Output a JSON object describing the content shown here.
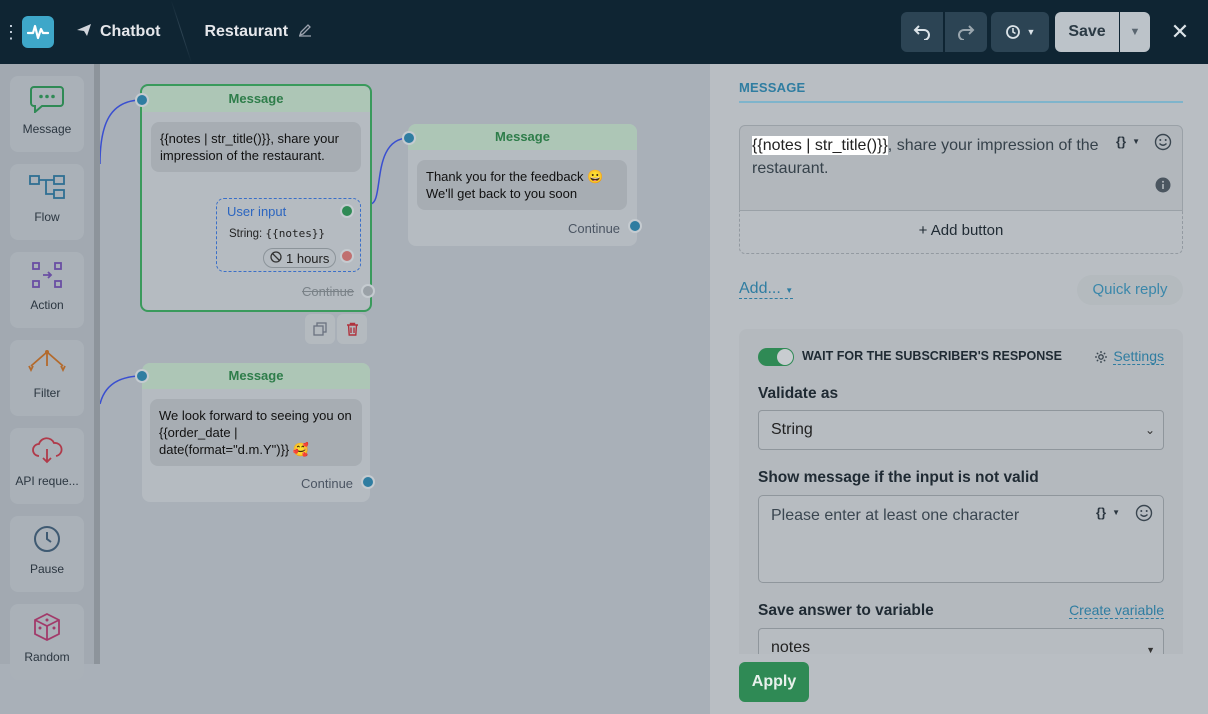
{
  "topbar": {
    "chatbot_label": "Chatbot",
    "project_name": "Restaurant",
    "save_label": "Save"
  },
  "palette": [
    {
      "label": "Message",
      "icon": "chat-bubble-icon"
    },
    {
      "label": "Flow",
      "icon": "flow-icon"
    },
    {
      "label": "Action",
      "icon": "action-icon"
    },
    {
      "label": "Filter",
      "icon": "filter-icon"
    },
    {
      "label": "API reque...",
      "icon": "api-cloud-icon"
    },
    {
      "label": "Pause",
      "icon": "clock-icon"
    },
    {
      "label": "Random",
      "icon": "dice-icon"
    }
  ],
  "canvas": {
    "node1": {
      "title": "Message",
      "text": "{{notes | str_title()}}, share your impression of the restaurant.",
      "user_input_label": "User input",
      "user_input_type": "String:",
      "user_input_var": "{{notes}}",
      "timeout": "1 hours",
      "continue": "Continue"
    },
    "node2": {
      "title": "Message",
      "text": "Thank you for the feedback 😀 We'll get back to you soon",
      "continue": "Continue"
    },
    "node3": {
      "title": "Message",
      "text": "We look forward to seeing you on {{order_date | date(format=\"d.m.Y\")}} 🥰",
      "continue": "Continue"
    }
  },
  "panel": {
    "tab_label": "MESSAGE",
    "message_highlight": "{{notes | str_title()}}",
    "message_rest": ", share your impression of the restaurant.",
    "add_button_label": "+ Add button",
    "add_label": "Add...",
    "quick_reply_label": "Quick reply",
    "wait_label": "WAIT FOR THE SUBSCRIBER'S RESPONSE",
    "settings_label": "Settings",
    "validate_label": "Validate as",
    "validate_value": "String",
    "invalid_label": "Show message if the input is not valid",
    "invalid_placeholder": "Please enter at least one character",
    "save_var_label": "Save answer to variable",
    "create_var_label": "Create variable",
    "variable_value": "notes",
    "apply_label": "Apply"
  }
}
